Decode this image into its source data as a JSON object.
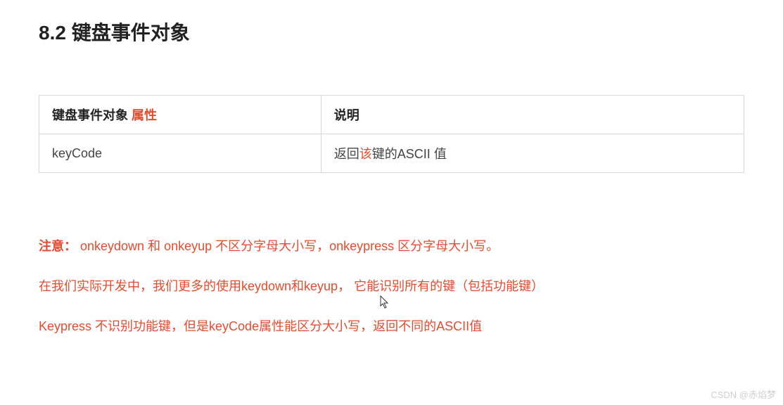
{
  "heading": "8.2 键盘事件对象",
  "table": {
    "header": {
      "col1_prefix": "键盘事件对象 ",
      "col1_highlight": "属性",
      "col2": "说明"
    },
    "rows": [
      {
        "col1": "keyCode",
        "col2_prefix": "返回",
        "col2_highlight": "该",
        "col2_suffix": "键的ASCII 值"
      }
    ]
  },
  "notes": {
    "label": "注意：",
    "line1": " onkeydown 和 onkeyup  不区分字母大小写，onkeypress 区分字母大小写。",
    "line2": "在我们实际开发中，我们更多的使用keydown和keyup， 它能识别所有的键（包括功能键）",
    "line3": "Keypress 不识别功能键，但是keyCode属性能区分大小写，返回不同的ASCII值"
  },
  "watermark": "CSDN @赤焰梦"
}
